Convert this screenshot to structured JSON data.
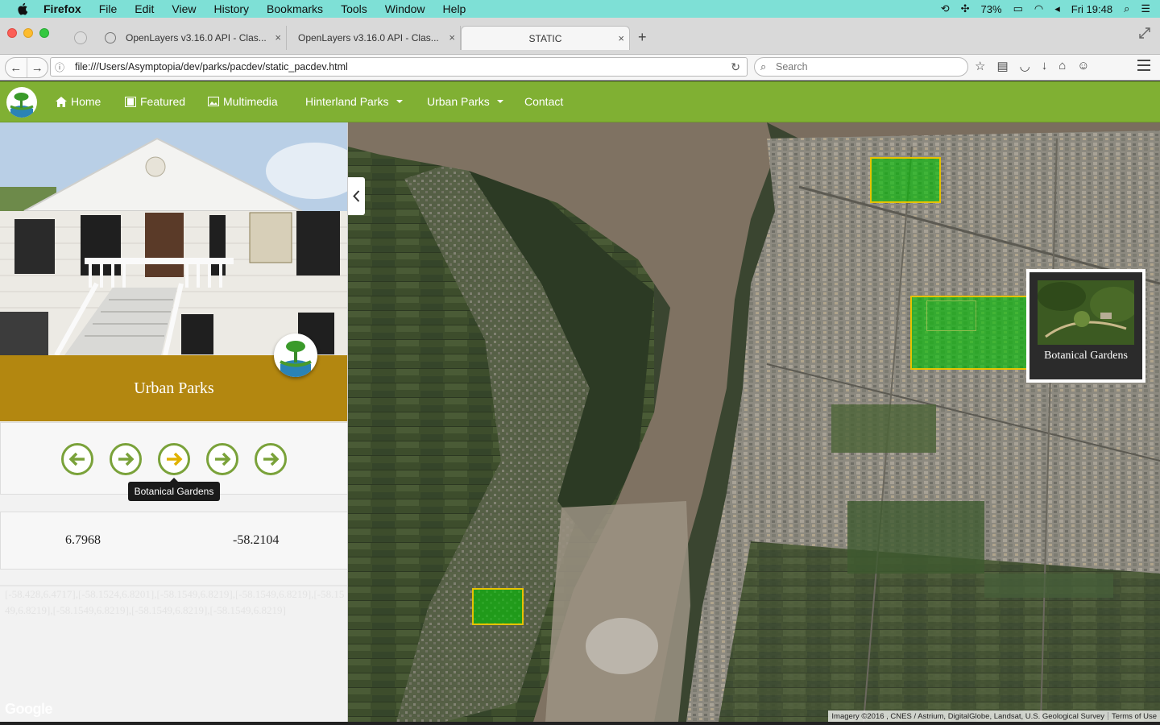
{
  "menubar": {
    "app": "Firefox",
    "items": [
      "File",
      "Edit",
      "View",
      "History",
      "Bookmarks",
      "Tools",
      "Window",
      "Help"
    ],
    "battery": "73%",
    "clock": "Fri 19:48"
  },
  "browser": {
    "tabs": [
      {
        "label": "OpenLayers v3.16.0 API - Clas..."
      },
      {
        "label": "OpenLayers v3.16.0 API - Clas..."
      },
      {
        "label": "STATIC"
      }
    ],
    "url": "file:///Users/Asymptopia/dev/parks/pacdev/static_pacdev.html",
    "search_placeholder": "Search"
  },
  "site_nav": {
    "items": [
      {
        "label": "Home",
        "icon": "home-icon"
      },
      {
        "label": "Featured",
        "icon": "film-icon"
      },
      {
        "label": "Multimedia",
        "icon": "picture-icon"
      },
      {
        "label": "Hinterland Parks",
        "dropdown": true
      },
      {
        "label": "Urban Parks",
        "dropdown": true
      },
      {
        "label": "Contact"
      }
    ]
  },
  "sidebar": {
    "title": "Urban Parks",
    "arrows": [
      "arrow-left",
      "arrow-right",
      "arrow-right",
      "arrow-right",
      "arrow-right"
    ],
    "active_arrow_index": 2,
    "tooltip": "Botanical Gardens",
    "latitude": "6.7968",
    "longitude": "-58.2104",
    "coords_text": "[-58.428,6.4717],[-58.1524,6.8201],[-58.1549,6.8219],[-58.1549,6.8219],[-58.1549,6.8219],[-58.1549,6.8219],[-58.1549,6.8219],[-58.1549,6.8219]",
    "google_watermark": "Google"
  },
  "map": {
    "popup_label": "Botanical Gardens",
    "attribution": "Imagery ©2016 , CNES / Astrium, DigitalGlobe, Landsat, U.S. Geological Survey",
    "terms": "Terms of Use",
    "highlight_color": "#00be00",
    "outline_color": "#e6c200"
  },
  "colors": {
    "nav_green": "#80b033",
    "title_gold": "#b38710",
    "arrow_green": "#7aa23a",
    "arrow_active": "#e0b200"
  }
}
